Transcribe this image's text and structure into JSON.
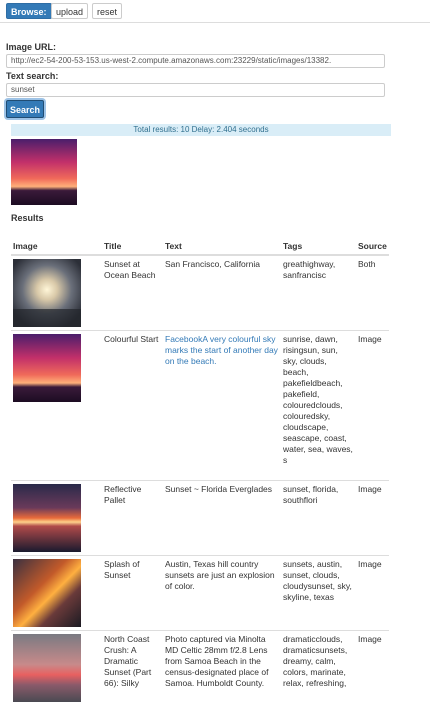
{
  "toolbar": {
    "browse_label": "Browse:",
    "upload_label": "upload",
    "reset_label": "reset"
  },
  "form": {
    "image_url_label": "Image URL:",
    "image_url_value": "http://ec2-54-200-53-153.us-west-2.compute.amazonaws.com:23229/static/images/13382.",
    "text_search_label": "Text search:",
    "text_search_value": "sunset",
    "search_button": "Search"
  },
  "status": "Total results: 10 Delay: 2.404 seconds",
  "results_heading": "Results",
  "table": {
    "headers": [
      "Image",
      "Title",
      "Text",
      "Tags",
      "Source"
    ],
    "rows": [
      {
        "title": "Sunset at Ocean Beach",
        "text": "San Francisco, California",
        "tags": "greathighway, sanfrancisc",
        "source": "Both",
        "text_is_link": false
      },
      {
        "title": "Colourful Start",
        "text": "FacebookA very colourful sky marks the start of another day on the beach.",
        "tags": "sunrise, dawn, risingsun, sun, sky, clouds, beach, pakefieldbeach, pakefield, colouredclouds, colouredsky, cloudscape, seascape, coast, water, sea, waves, s",
        "source": "Image",
        "text_is_link": true
      },
      {
        "title": "Reflective Pallet",
        "text": "Sunset ~ Florida Everglades",
        "tags": "sunset, florida, southflori",
        "source": "Image",
        "text_is_link": false
      },
      {
        "title": "Splash of Sunset",
        "text": "Austin, Texas hill country sunsets are just an explosion of color.",
        "tags": "sunsets, austin, sunset, clouds, cloudysunset, sky, skyline, texas",
        "source": "Image",
        "text_is_link": false
      },
      {
        "title": "North Coast Crush: A Dramatic Sunset (Part 66): Silky",
        "text": "Photo captured via Minolta MD Celtic 28mm f/2.8 Lens from Samoa Beach in the census-designated place of Samoa. Humboldt County.",
        "tags": "dramaticclouds, dramaticsunsets, dreamy, calm, colors, marinate, relax, refreshing,",
        "source": "Image",
        "text_is_link": false
      }
    ]
  }
}
